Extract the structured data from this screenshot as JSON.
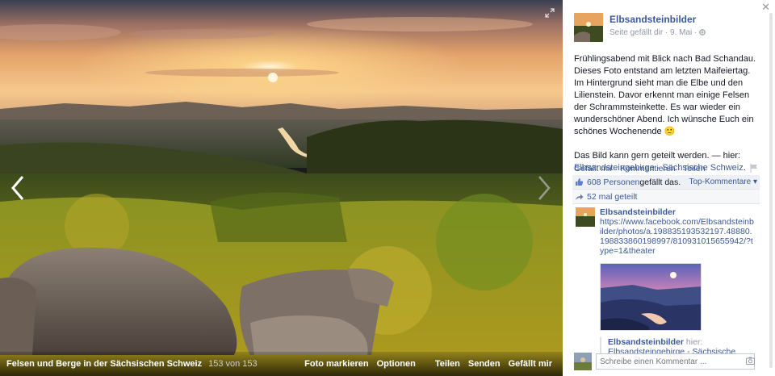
{
  "photo": {
    "caption": "Felsen und Berge in der Sächsischen Schweiz",
    "counter": "153 von 153",
    "actions": [
      "Foto markieren",
      "Optionen",
      "Teilen",
      "Senden",
      "Gefällt mir"
    ],
    "icons": {
      "prev": "chevron-left-icon",
      "next": "chevron-right-icon",
      "expand": "expand-icon"
    }
  },
  "post": {
    "page_name": "Elbsandsteinbilder",
    "meta": "Seite gefällt dir · 9. Mai ·",
    "text_1": "Frühlingsabend mit Blick nach Bad Schandau. Dieses Foto entstand am letzten Maifeiertag. Im Hintergrund sieht man die Elbe und den Lilienstein. Davor erkennt man einige Felsen der Schrammsteinkette. Es war wieder ein wunderschöner Abend. Ich wünsche Euch ein schönes Wochenende",
    "emoji": "🙂",
    "text_2_prefix": "Das Bild kann gern geteilt werden. — hier:",
    "text_2_link": "Elbsandsteingebirge - Sächsische Schweiz",
    "text_2_suffix": ".",
    "actions": {
      "like": "Gefällt mir",
      "comment": "Kommentieren",
      "share": "Teilen",
      "sep": "·"
    }
  },
  "ufi": {
    "likes_count": "608 Personen",
    "likes_suffix": " gefällt das.",
    "top_comments": "Top-Kommentare ▾",
    "shares": "52 mal geteilt"
  },
  "comment": {
    "author": "Elbsandsteinbilder",
    "url": "https://www.facebook.com/Elbsandsteinbilder/photos/a.198835193532197.48880.198833860198997/810931015655942/?type=1&theater",
    "share_author": "Elbsandsteinbilder",
    "share_text": " hier:",
    "share_link": "Elbsandsteingebirge - Sächsische Schweiz"
  },
  "compose": {
    "placeholder": "Schreibe einen Kommentar ..."
  },
  "colors": {
    "link": "#3b5998",
    "muted": "#9197a3",
    "sidebar_bg": "#ffffff"
  }
}
